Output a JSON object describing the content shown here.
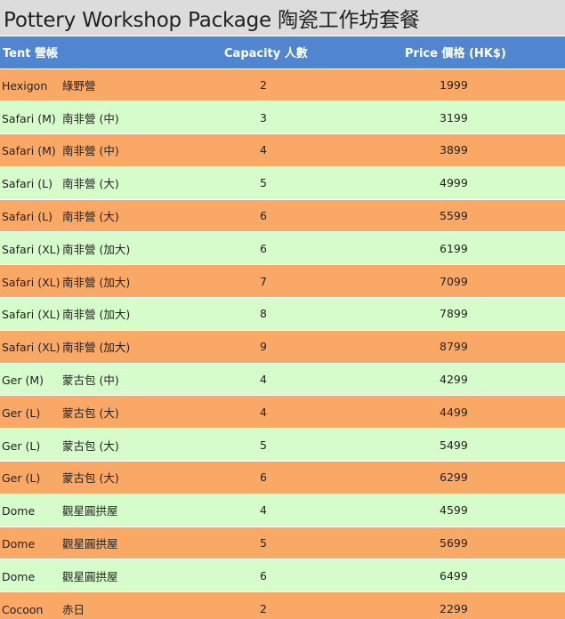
{
  "title": "Pottery Workshop Package 陶瓷工作坊套餐",
  "table": {
    "headers": {
      "tent": "Tent 營帳",
      "capacity": "Capacity 人數",
      "price": "Price 價格 (HK$)"
    },
    "rows": [
      {
        "tent_en": "Hexigon",
        "tent_zh": "綠野營",
        "capacity": "2",
        "price": "1999"
      },
      {
        "tent_en": "Safari (M)",
        "tent_zh": "南非營 (中)",
        "capacity": "3",
        "price": "3199"
      },
      {
        "tent_en": "Safari (M)",
        "tent_zh": "南非營 (中)",
        "capacity": "4",
        "price": "3899"
      },
      {
        "tent_en": "Safari (L)",
        "tent_zh": "南非營 (大)",
        "capacity": "5",
        "price": "4999"
      },
      {
        "tent_en": "Safari (L)",
        "tent_zh": "南非營 (大)",
        "capacity": "6",
        "price": "5599"
      },
      {
        "tent_en": "Safari (XL)",
        "tent_zh": "南非營 (加大)",
        "capacity": "6",
        "price": "6199"
      },
      {
        "tent_en": "Safari (XL)",
        "tent_zh": "南非營 (加大)",
        "capacity": "7",
        "price": "7099"
      },
      {
        "tent_en": "Safari (XL)",
        "tent_zh": "南非營 (加大)",
        "capacity": "8",
        "price": "7899"
      },
      {
        "tent_en": "Safari (XL)",
        "tent_zh": "南非營 (加大)",
        "capacity": "9",
        "price": "8799"
      },
      {
        "tent_en": "Ger (M)",
        "tent_zh": "蒙古包 (中)",
        "capacity": "4",
        "price": "4299"
      },
      {
        "tent_en": "Ger (L)",
        "tent_zh": "蒙古包 (大)",
        "capacity": "4",
        "price": "4499"
      },
      {
        "tent_en": "Ger (L)",
        "tent_zh": "蒙古包 (大)",
        "capacity": "5",
        "price": "5499"
      },
      {
        "tent_en": "Ger (L)",
        "tent_zh": "蒙古包 (大)",
        "capacity": "6",
        "price": "6299"
      },
      {
        "tent_en": "Dome",
        "tent_zh": "觀星圓拱屋",
        "capacity": "4",
        "price": "4599"
      },
      {
        "tent_en": "Dome",
        "tent_zh": "觀星圓拱屋",
        "capacity": "5",
        "price": "5699"
      },
      {
        "tent_en": "Dome",
        "tent_zh": "觀星圓拱屋",
        "capacity": "6",
        "price": "6499"
      },
      {
        "tent_en": "Cocoon",
        "tent_zh": "赤日",
        "capacity": "2",
        "price": "2299"
      }
    ]
  },
  "colors": {
    "header": "#4f86cf",
    "row_odd": "#f9a866",
    "row_even": "#d6fccb",
    "title_bar": "#dcdcdc"
  }
}
